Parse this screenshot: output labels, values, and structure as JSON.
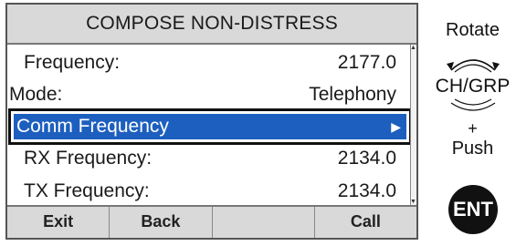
{
  "screen": {
    "title": "COMPOSE NON-DISTRESS",
    "rows": [
      {
        "label": "Frequency:",
        "value": "2177.0"
      },
      {
        "label": "Mode:",
        "value": "Telephony"
      },
      {
        "label": "Comm Frequency",
        "value": ""
      },
      {
        "label": "RX Frequency:",
        "value": "2134.0"
      },
      {
        "label": "TX Frequency:",
        "value": "2134.0"
      }
    ],
    "softkeys": [
      "Exit",
      "Back",
      "",
      "Call"
    ]
  },
  "side": {
    "rotate": "Rotate",
    "knob_label": "CH/GRP",
    "plus": "+",
    "push": "Push",
    "ent": "ENT"
  },
  "colors": {
    "selection": "#1d5fbf",
    "header_bg": "#d9d9d9"
  }
}
